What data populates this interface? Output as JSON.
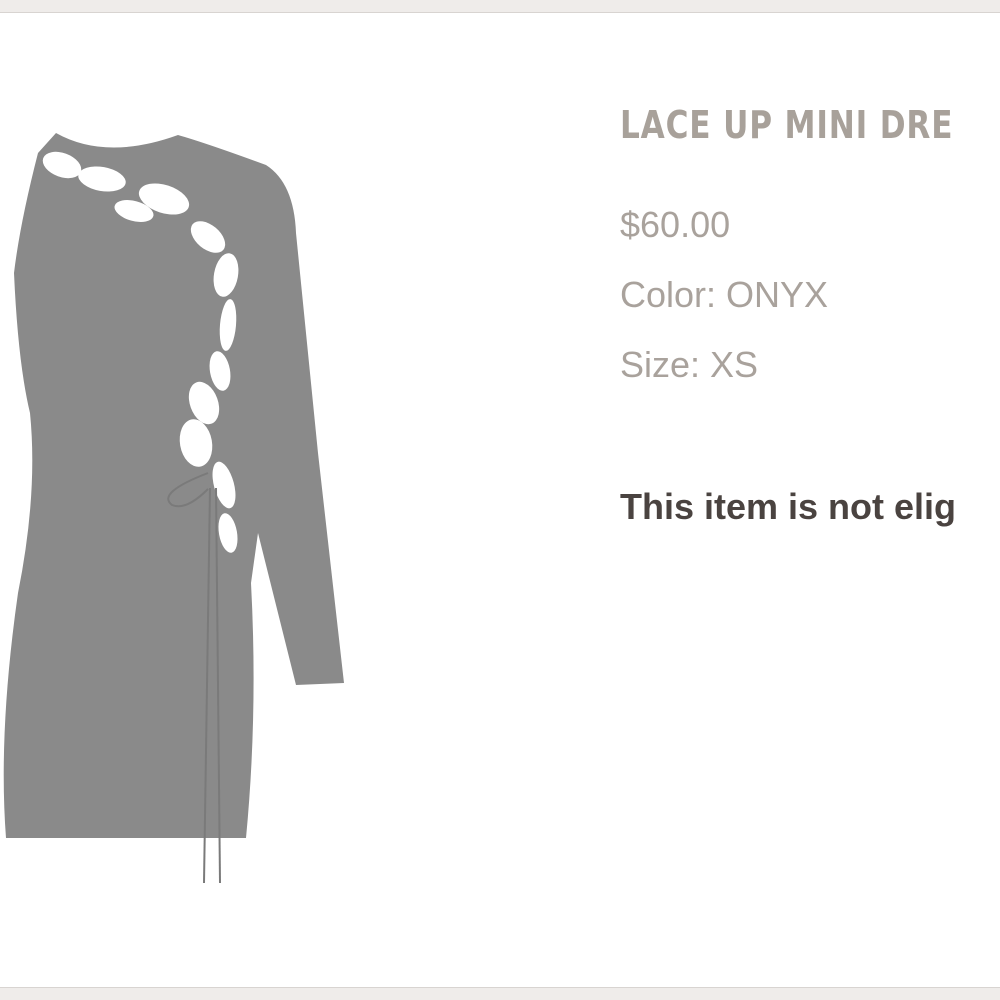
{
  "product": {
    "title": "LACE UP MINI DRE",
    "price": "$60.00",
    "color": "Color: ONYX",
    "size": "Size: XS",
    "notice": "This item is not elig",
    "image_icon": "dress-image"
  },
  "colors": {
    "dress": "#8a8a8a",
    "title": "#a8a19a",
    "meta": "#a9a29c",
    "notice": "#4a4340",
    "background": "#efecea",
    "card": "#ffffff"
  }
}
